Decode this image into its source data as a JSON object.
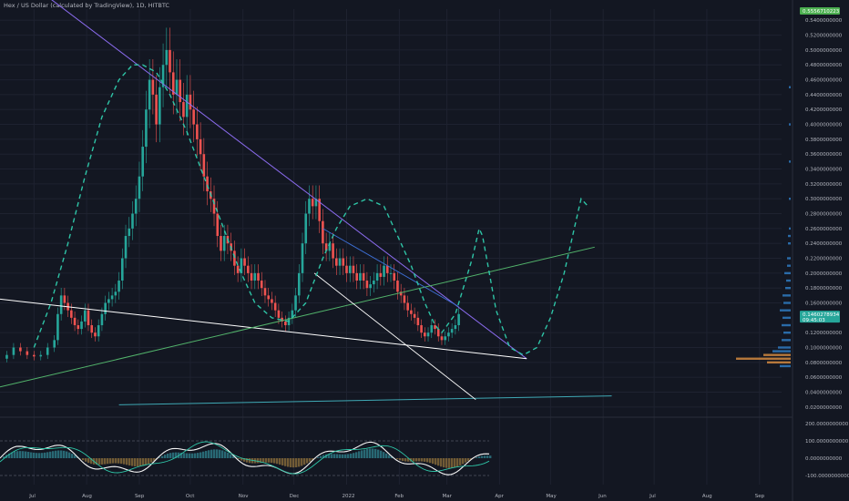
{
  "header": {
    "symbol_title": "Hex / US Dollar (calculated by TradingView), 1D, HITBTC"
  },
  "colors": {
    "background": "#131722",
    "grid": "#1e2230",
    "axis_text": "#b2b5be",
    "up_candle": "#26a69a",
    "down_candle": "#ef5350",
    "upper_trendline": "#8c6cf0",
    "support_line": "#ffffff",
    "green_trendline": "#52b36b",
    "teal_line": "#3fa9b5",
    "blue_channel": "#3d6fd6",
    "projection": "#2ec4a6",
    "price_badge": "#26a69a",
    "label_badge_top": "#4caf50"
  },
  "chart_data": {
    "type": "line",
    "title": "",
    "xlabel": "",
    "ylabel": "",
    "x_labels": [
      "Jul",
      "Aug",
      "Sep",
      "Oct",
      "Nov",
      "Dec",
      "2022",
      "Feb",
      "Mar",
      "Apr",
      "May",
      "Jun",
      "Jul",
      "Aug",
      "Sep"
    ],
    "x_label_days": [
      0,
      31,
      62,
      92,
      123,
      153,
      184,
      215,
      243,
      274,
      304,
      335,
      365,
      396,
      427
    ],
    "x_range": [
      -20,
      440
    ],
    "y_ticks": [
      "0.5400000000",
      "0.5200000000",
      "0.5000000000",
      "0.4800000000",
      "0.4600000000",
      "0.4400000000",
      "0.4200000000",
      "0.4000000000",
      "0.3800000000",
      "0.3600000000",
      "0.3400000000",
      "0.3200000000",
      "0.3000000000",
      "0.2800000000",
      "0.2600000000",
      "0.2400000000",
      "0.2200000000",
      "0.2000000000",
      "0.1800000000",
      "0.1600000000",
      "0.1200000000",
      "0.1000000000",
      "0.0800000000",
      "0.0600000000",
      "0.0400000000",
      "0.0200000000"
    ],
    "ylim": [
      0.01,
      0.555
    ],
    "grid": true,
    "price_badges": [
      {
        "label": "0.5556710223",
        "value": 0.5525
      },
      {
        "label": "0.1460278934",
        "sub": "09:45:03",
        "value": 0.1445
      }
    ],
    "series": [
      {
        "kind": "candles",
        "points": [
          [
            -20,
            0.085
          ],
          [
            -16,
            0.09
          ],
          [
            -12,
            0.1
          ],
          [
            -8,
            0.095
          ],
          [
            -4,
            0.09
          ],
          [
            0,
            0.088
          ],
          [
            4,
            0.09
          ],
          [
            8,
            0.1
          ],
          [
            12,
            0.11
          ],
          [
            14,
            0.145
          ],
          [
            16,
            0.17
          ],
          [
            18,
            0.16
          ],
          [
            20,
            0.15
          ],
          [
            22,
            0.14
          ],
          [
            24,
            0.13
          ],
          [
            26,
            0.125
          ],
          [
            28,
            0.135
          ],
          [
            30,
            0.15
          ],
          [
            32,
            0.13
          ],
          [
            34,
            0.12
          ],
          [
            36,
            0.115
          ],
          [
            38,
            0.13
          ],
          [
            40,
            0.145
          ],
          [
            42,
            0.16
          ],
          [
            44,
            0.165
          ],
          [
            46,
            0.17
          ],
          [
            48,
            0.175
          ],
          [
            50,
            0.19
          ],
          [
            52,
            0.22
          ],
          [
            54,
            0.25
          ],
          [
            56,
            0.26
          ],
          [
            58,
            0.28
          ],
          [
            60,
            0.3
          ],
          [
            62,
            0.33
          ],
          [
            64,
            0.37
          ],
          [
            66,
            0.42
          ],
          [
            68,
            0.46
          ],
          [
            70,
            0.44
          ],
          [
            72,
            0.4
          ],
          [
            74,
            0.45
          ],
          [
            76,
            0.48
          ],
          [
            78,
            0.5
          ],
          [
            80,
            0.47
          ],
          [
            82,
            0.44
          ],
          [
            84,
            0.46
          ],
          [
            86,
            0.43
          ],
          [
            88,
            0.41
          ],
          [
            90,
            0.44
          ],
          [
            92,
            0.42
          ],
          [
            94,
            0.4
          ],
          [
            96,
            0.38
          ],
          [
            98,
            0.36
          ],
          [
            100,
            0.33
          ],
          [
            102,
            0.31
          ],
          [
            104,
            0.3
          ],
          [
            106,
            0.28
          ],
          [
            108,
            0.25
          ],
          [
            110,
            0.23
          ],
          [
            112,
            0.25
          ],
          [
            114,
            0.24
          ],
          [
            116,
            0.23
          ],
          [
            118,
            0.21
          ],
          [
            120,
            0.2
          ],
          [
            122,
            0.22
          ],
          [
            124,
            0.21
          ],
          [
            126,
            0.2
          ],
          [
            128,
            0.19
          ],
          [
            130,
            0.2
          ],
          [
            132,
            0.19
          ],
          [
            134,
            0.18
          ],
          [
            136,
            0.17
          ],
          [
            138,
            0.165
          ],
          [
            140,
            0.16
          ],
          [
            142,
            0.15
          ],
          [
            144,
            0.14
          ],
          [
            146,
            0.135
          ],
          [
            148,
            0.13
          ],
          [
            150,
            0.14
          ],
          [
            152,
            0.15
          ],
          [
            154,
            0.17
          ],
          [
            156,
            0.2
          ],
          [
            158,
            0.24
          ],
          [
            160,
            0.28
          ],
          [
            162,
            0.3
          ],
          [
            164,
            0.29
          ],
          [
            166,
            0.3
          ],
          [
            168,
            0.27
          ],
          [
            170,
            0.24
          ],
          [
            172,
            0.23
          ],
          [
            174,
            0.24
          ],
          [
            176,
            0.22
          ],
          [
            178,
            0.21
          ],
          [
            180,
            0.22
          ],
          [
            182,
            0.21
          ],
          [
            184,
            0.2
          ],
          [
            186,
            0.21
          ],
          [
            188,
            0.2
          ],
          [
            190,
            0.19
          ],
          [
            192,
            0.2
          ],
          [
            194,
            0.19
          ],
          [
            196,
            0.18
          ],
          [
            198,
            0.185
          ],
          [
            200,
            0.19
          ],
          [
            202,
            0.2
          ],
          [
            204,
            0.195
          ],
          [
            206,
            0.21
          ],
          [
            208,
            0.2
          ],
          [
            210,
            0.2
          ],
          [
            212,
            0.19
          ],
          [
            214,
            0.175
          ],
          [
            216,
            0.17
          ],
          [
            218,
            0.16
          ],
          [
            220,
            0.15
          ],
          [
            222,
            0.145
          ],
          [
            224,
            0.14
          ],
          [
            226,
            0.13
          ],
          [
            228,
            0.12
          ],
          [
            230,
            0.115
          ],
          [
            232,
            0.12
          ],
          [
            234,
            0.13
          ],
          [
            236,
            0.125
          ],
          [
            238,
            0.115
          ],
          [
            240,
            0.11
          ],
          [
            242,
            0.115
          ],
          [
            244,
            0.12
          ],
          [
            246,
            0.125
          ],
          [
            248,
            0.13
          ],
          [
            250,
            0.145
          ]
        ]
      },
      {
        "kind": "line",
        "role": "upper-trendline",
        "points": [
          [
            -20,
            0.62
          ],
          [
            290,
            0.085
          ]
        ]
      },
      {
        "kind": "line",
        "role": "support-line",
        "points": [
          [
            -20,
            0.165
          ],
          [
            290,
            0.085
          ]
        ]
      },
      {
        "kind": "line",
        "role": "green-trendline",
        "points": [
          [
            -20,
            0.047
          ],
          [
            330,
            0.235
          ]
        ]
      },
      {
        "kind": "line",
        "role": "teal-line",
        "points": [
          [
            50,
            0.023
          ],
          [
            340,
            0.035
          ]
        ]
      },
      {
        "kind": "line",
        "role": "lower-white-line",
        "points": [
          [
            165,
            0.2
          ],
          [
            260,
            0.03
          ]
        ]
      },
      {
        "kind": "line",
        "role": "blue-channel",
        "points": [
          [
            170,
            0.26
          ],
          [
            250,
            0.155
          ]
        ]
      },
      {
        "kind": "dashed",
        "role": "projection-path",
        "points": [
          [
            0,
            0.1
          ],
          [
            10,
            0.16
          ],
          [
            20,
            0.24
          ],
          [
            30,
            0.33
          ],
          [
            40,
            0.41
          ],
          [
            50,
            0.46
          ],
          [
            58,
            0.48
          ],
          [
            64,
            0.48
          ],
          [
            72,
            0.47
          ],
          [
            80,
            0.44
          ],
          [
            90,
            0.39
          ],
          [
            100,
            0.33
          ],
          [
            110,
            0.27
          ],
          [
            120,
            0.21
          ],
          [
            130,
            0.16
          ],
          [
            140,
            0.14
          ],
          [
            150,
            0.135
          ],
          [
            160,
            0.16
          ],
          [
            170,
            0.22
          ],
          [
            178,
            0.26
          ],
          [
            186,
            0.29
          ],
          [
            196,
            0.3
          ],
          [
            206,
            0.29
          ],
          [
            214,
            0.25
          ],
          [
            222,
            0.21
          ],
          [
            230,
            0.16
          ],
          [
            236,
            0.13
          ],
          [
            240,
            0.12
          ],
          [
            248,
            0.145
          ],
          [
            254,
            0.19
          ],
          [
            258,
            0.22
          ],
          [
            262,
            0.26
          ],
          [
            264,
            0.25
          ],
          [
            268,
            0.2
          ],
          [
            272,
            0.15
          ],
          [
            280,
            0.1
          ],
          [
            288,
            0.09
          ],
          [
            296,
            0.1
          ],
          [
            304,
            0.14
          ],
          [
            312,
            0.2
          ],
          [
            318,
            0.26
          ],
          [
            322,
            0.3
          ],
          [
            326,
            0.29
          ]
        ]
      }
    ]
  },
  "oscillator": {
    "y_ticks": [
      "200.0000000000",
      "100.0000000000",
      "0.0000000000",
      "-100.0000000000"
    ]
  }
}
